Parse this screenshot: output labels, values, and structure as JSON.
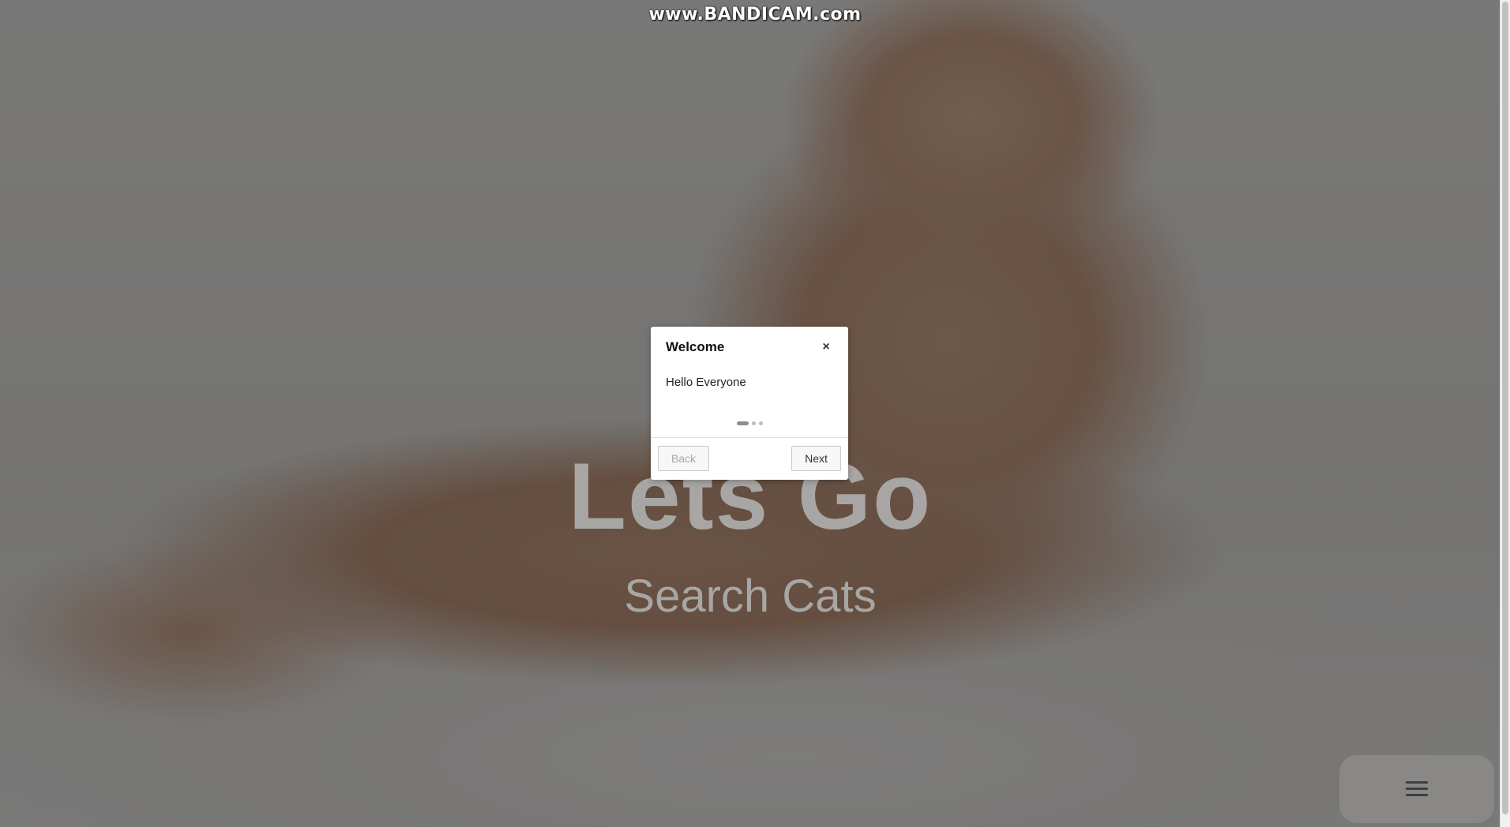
{
  "watermark": "www.BANDICAM.com",
  "hero": {
    "title": "Lets Go",
    "subtitle": "Search Cats"
  },
  "modal": {
    "title": "Welcome",
    "close_icon": "×",
    "body": "Hello Everyone",
    "steps_total": 3,
    "step_current": 1,
    "back_label": "Back",
    "next_label": "Next"
  },
  "menu_fab": {
    "icon": "hamburger-menu-icon"
  }
}
